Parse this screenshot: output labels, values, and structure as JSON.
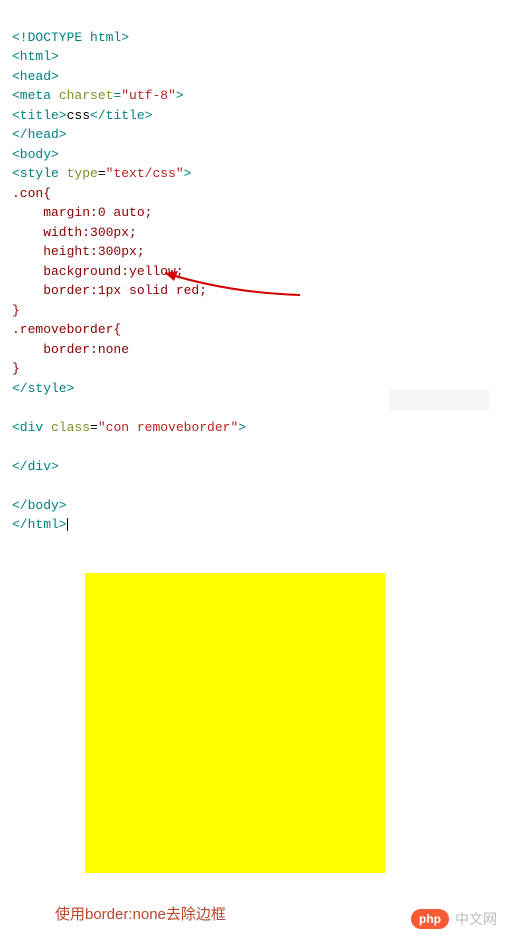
{
  "code": {
    "l1": "<!DOCTYPE html>",
    "l2": "<html>",
    "l3": "<head>",
    "l4_open": "<meta ",
    "l4_attr": "charset",
    "l4_eq": "=",
    "l4_val": "\"utf-8\"",
    "l4_close": ">",
    "l5_open": "<title>",
    "l5_text": "css",
    "l5_close": "</title>",
    "l6": "</head>",
    "l7": "<body>",
    "l8_open": "<style ",
    "l8_attr": "type",
    "l8_eq": "=",
    "l8_val": "\"text/css\"",
    "l8_close": ">",
    "sel1": ".con",
    "brace_open": "{",
    "p1_k": "    margin",
    "p1_v": ":0 auto;",
    "p2_k": "    width",
    "p2_v": ":300px;",
    "p3_k": "    height",
    "p3_v": ":300px;",
    "p4_k": "    background",
    "p4_v": ":yellow;",
    "p5_k": "    border",
    "p5_v": ":1px solid red;",
    "brace_close": "}",
    "sel2": ".removeborder",
    "p6_k": "    border",
    "p6_v": ":none",
    "l_style_close": "</style>",
    "div_open": "<div ",
    "div_attr": "class",
    "div_eq": "=",
    "div_val": "\"con removeborder\"",
    "div_close": ">",
    "div_end": "</div>",
    "body_close": "</body>",
    "html_close": "</html>"
  },
  "caption": "使用border:none去除边框",
  "logo_pill": "php",
  "logo_text": "中文网"
}
